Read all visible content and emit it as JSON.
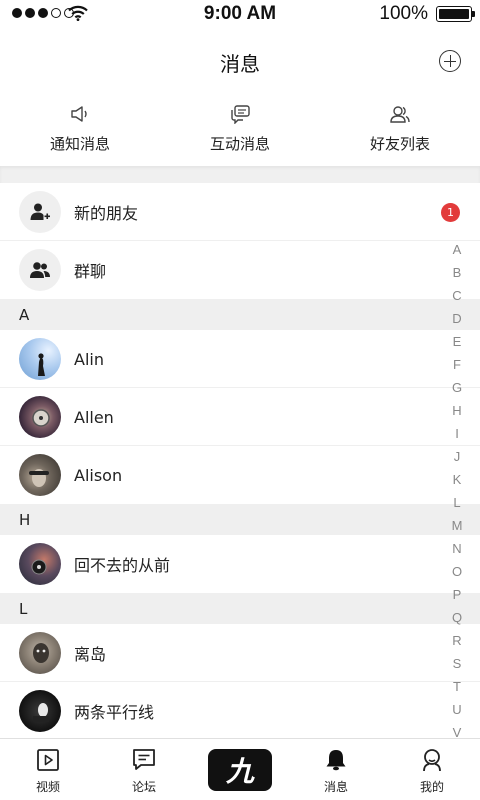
{
  "status_bar": {
    "time": "9:00 AM",
    "battery": "100%",
    "signal_bars": 3,
    "signal_total": 5
  },
  "header": {
    "title": "消息",
    "action_icon": "plus-circle-icon"
  },
  "top_tabs": [
    {
      "label": "通知消息",
      "icon": "speaker-icon"
    },
    {
      "label": "互动消息",
      "icon": "chat-bubbles-icon"
    },
    {
      "label": "好友列表",
      "icon": "friends-icon"
    }
  ],
  "special_rows": [
    {
      "label": "新的朋友",
      "icon": "add-person-icon",
      "badge": "1"
    },
    {
      "label": "群聊",
      "icon": "group-icon"
    }
  ],
  "sections": [
    {
      "letter": "A",
      "contacts": [
        "Alin",
        "Allen",
        "Alison"
      ]
    },
    {
      "letter": "H",
      "contacts": [
        "回不去的从前"
      ]
    },
    {
      "letter": "L",
      "contacts": [
        "离岛",
        "两条平行线"
      ]
    }
  ],
  "alphabet": [
    "A",
    "B",
    "C",
    "D",
    "E",
    "F",
    "G",
    "H",
    "I",
    "J",
    "K",
    "L",
    "M",
    "N",
    "O",
    "P",
    "Q",
    "R",
    "S",
    "T",
    "U",
    "V"
  ],
  "bottom_nav": [
    {
      "label": "视频",
      "icon": "video-icon"
    },
    {
      "label": "论坛",
      "icon": "forum-icon"
    },
    {
      "label": "",
      "icon": "app-logo",
      "logo_text": "九"
    },
    {
      "label": "消息",
      "icon": "bell-icon"
    },
    {
      "label": "我的",
      "icon": "profile-icon"
    }
  ],
  "colors": {
    "badge": "#e23b3b",
    "section_bg": "#efefef",
    "text": "#222222"
  }
}
